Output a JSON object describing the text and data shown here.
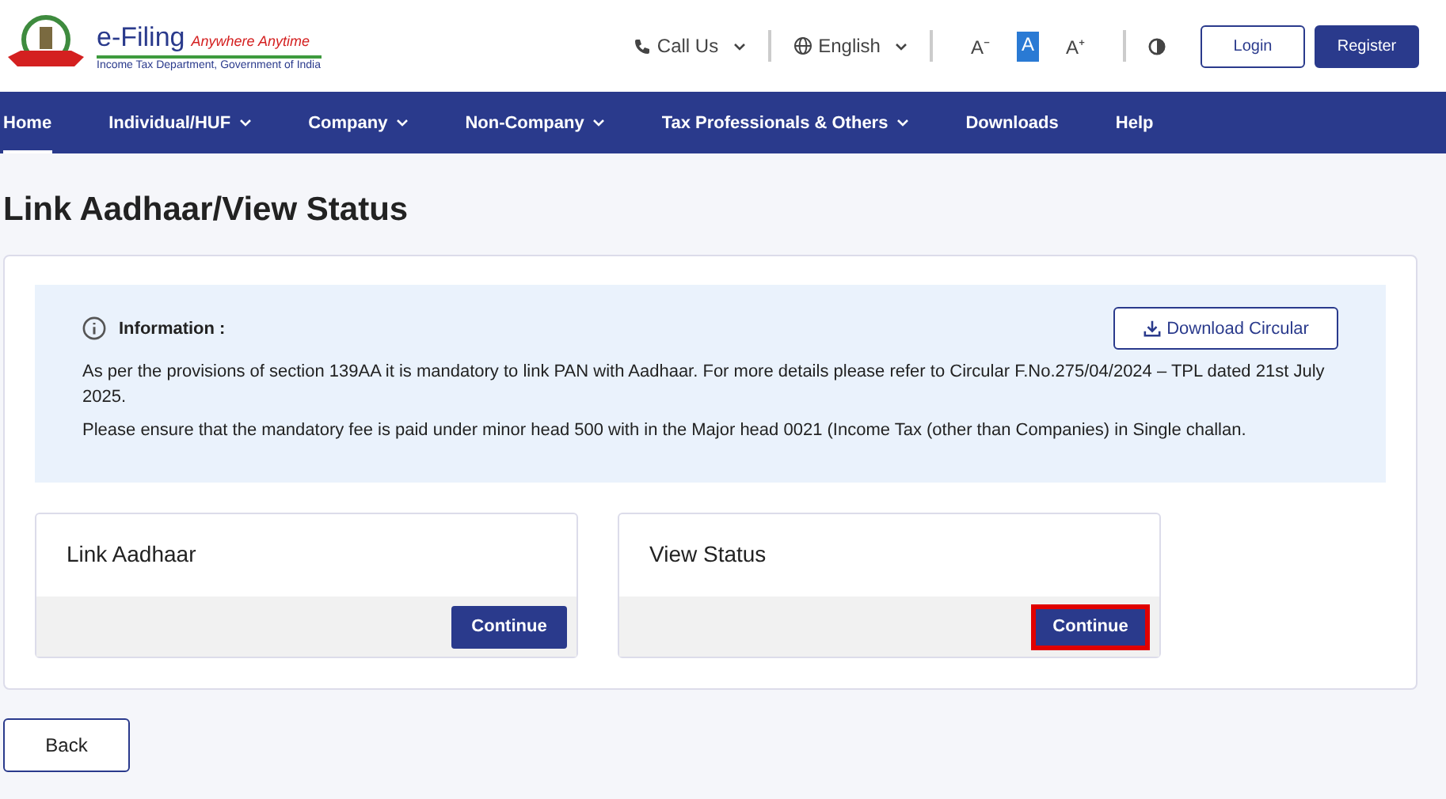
{
  "header": {
    "logo": {
      "title": "e-Filing",
      "tagline": "Anywhere Anytime",
      "subtitle": "Income Tax Department, Government of India"
    },
    "call_us": "Call Us",
    "language": "English",
    "text_size": [
      {
        "label": "A⁻",
        "selected": false
      },
      {
        "label": "A",
        "selected": true
      },
      {
        "label": "A⁺",
        "selected": false
      }
    ],
    "login": "Login",
    "register": "Register"
  },
  "nav": [
    {
      "label": "Home",
      "selected": true,
      "has_menu": false
    },
    {
      "label": "Individual/HUF",
      "selected": false,
      "has_menu": true
    },
    {
      "label": "Company",
      "selected": false,
      "has_menu": true
    },
    {
      "label": "Non-Company",
      "selected": false,
      "has_menu": true
    },
    {
      "label": "Tax Professionals & Others",
      "selected": false,
      "has_menu": true
    },
    {
      "label": "Downloads",
      "selected": false,
      "has_menu": false
    },
    {
      "label": "Help",
      "selected": false,
      "has_menu": false
    }
  ],
  "page_title": "Link Aadhaar/View Status",
  "info": {
    "heading": "Information :",
    "download": "Download Circular",
    "paragraphs": [
      "As per the provisions of section 139AA it is mandatory to link PAN with Aadhaar. For more details please refer to Circular F.No.275/04/2024 – TPL dated 21st July 2025.",
      "Please ensure that the mandatory fee is paid under minor head 500 with in the Major head 0021 (Income Tax (other than Companies) in Single challan."
    ]
  },
  "options": [
    {
      "title": "Link Aadhaar",
      "button": "Continue",
      "highlighted": false
    },
    {
      "title": "View Status",
      "button": "Continue",
      "highlighted": true
    }
  ],
  "back": "Back"
}
